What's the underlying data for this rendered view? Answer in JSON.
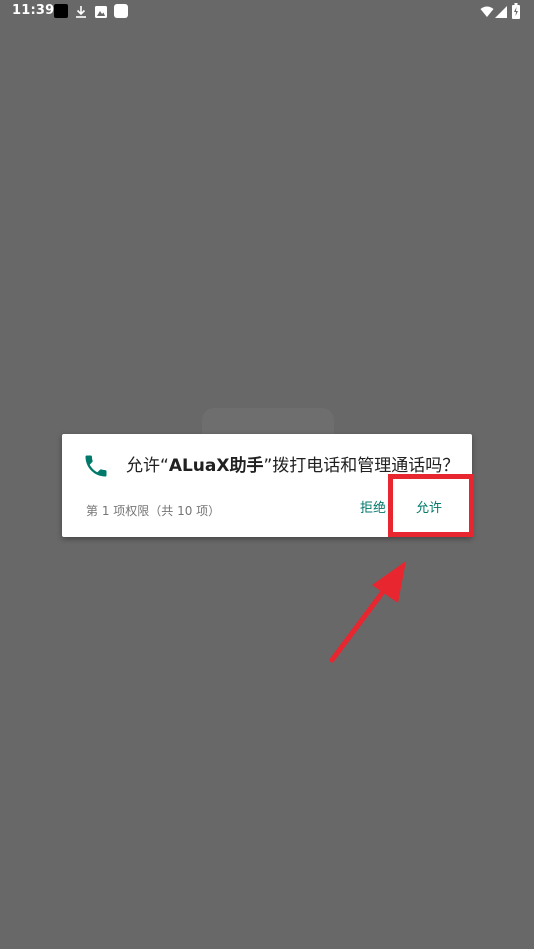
{
  "status_bar": {
    "time": "11:39",
    "icons": [
      "black-square-notification-icon",
      "download-icon",
      "photo-icon",
      "white-square-notification-icon",
      "wifi-icon",
      "signal-icon",
      "battery-icon"
    ]
  },
  "dialog": {
    "icon": "phone-icon",
    "title_prefix": "允许“",
    "app_name": "ALuaX助手",
    "title_suffix": "”拨打电话和管理通话吗？",
    "counter": "第 1 项权限（共 10 项）",
    "deny_label": "拒绝",
    "allow_label": "允许"
  },
  "colors": {
    "scrim": "#686868",
    "accent": "#00796b",
    "annotation": "#e8262f"
  }
}
